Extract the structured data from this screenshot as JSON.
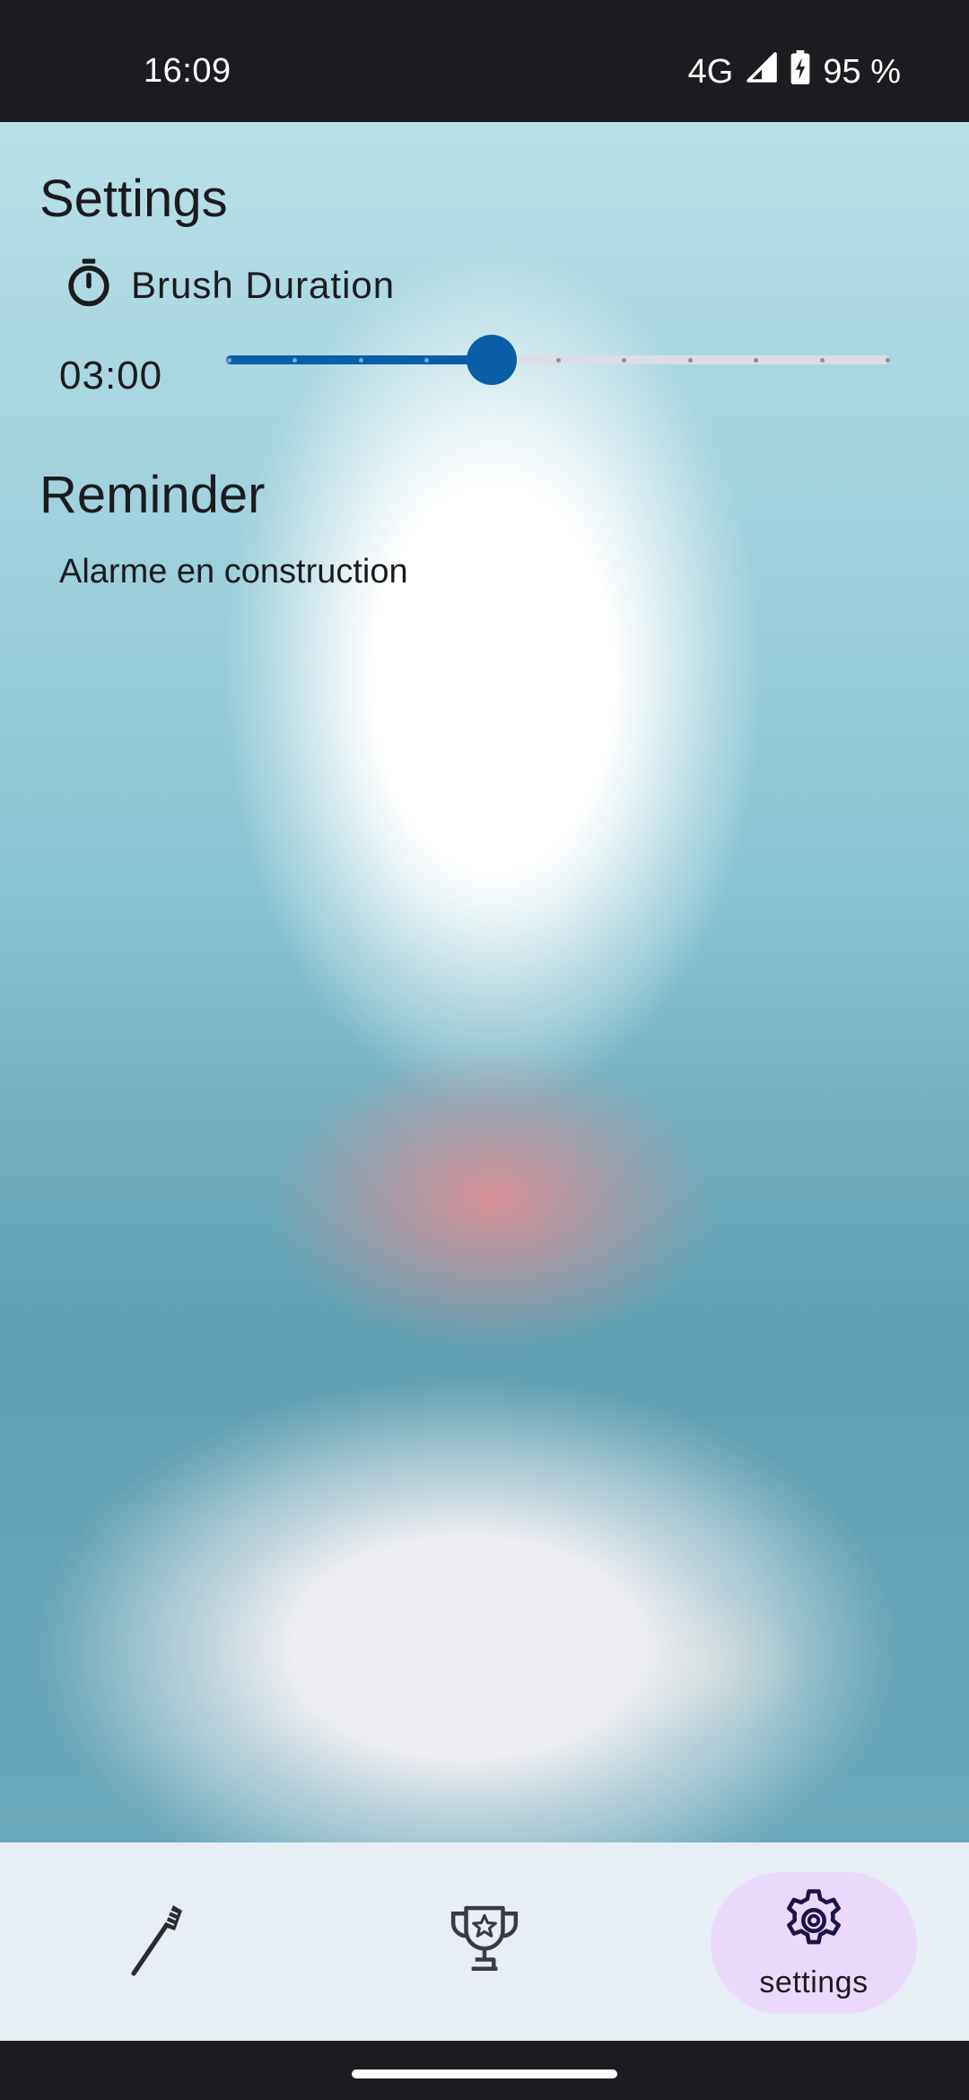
{
  "status_bar": {
    "time": "16:09",
    "network": "4G",
    "battery": "95 %"
  },
  "settings": {
    "title": "Settings",
    "brush_duration": {
      "icon": "timer-icon",
      "label": "Brush Duration",
      "value_text": "03:00",
      "slider": {
        "steps": 11,
        "selected_index": 4,
        "fraction": 0.4
      }
    }
  },
  "reminder": {
    "title": "Reminder",
    "text": "Alarme en construction"
  },
  "bottom_nav": {
    "items": [
      {
        "icon": "toothbrush-icon",
        "label": "",
        "selected": false
      },
      {
        "icon": "trophy-icon",
        "label": "",
        "selected": false
      },
      {
        "icon": "gear-icon",
        "label": "settings",
        "selected": true
      }
    ]
  },
  "colors": {
    "accent": "#0a5ea8",
    "nav_selected_bg": "#ead9fb",
    "nav_bg": "#e8eef6",
    "track_inactive": "#dcdde8"
  }
}
